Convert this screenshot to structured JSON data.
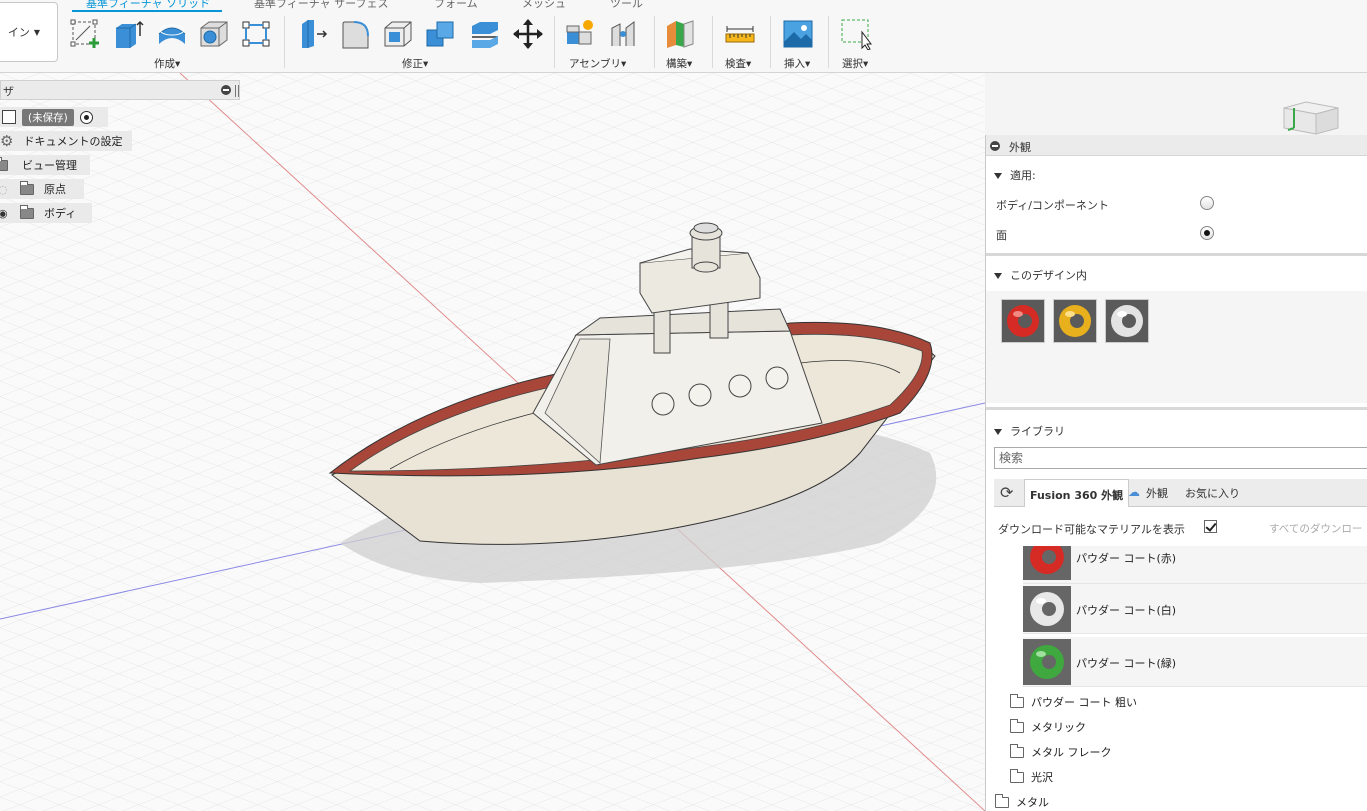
{
  "toolbar": {
    "workspace_label": "イン",
    "tabs": [
      {
        "label": "基準フィーチャ ソリッド",
        "active": true
      },
      {
        "label": "基準フィーチャ サーフェス",
        "active": false
      },
      {
        "label": "フォーム",
        "active": false
      },
      {
        "label": "メッシュ",
        "active": false
      },
      {
        "label": "ツール",
        "active": false
      }
    ],
    "groups": {
      "create": "作成▾",
      "modify": "修正▾",
      "assemble": "アセンブリ▾",
      "construct": "構築▾",
      "inspect": "検査▾",
      "insert": "挿入▾",
      "select": "選択▾"
    }
  },
  "browser": {
    "title": "ザ",
    "document": "(未保存)",
    "items": [
      {
        "label": "ドキュメントの設定",
        "icon": "gear-icon"
      },
      {
        "label": "ビュー管理",
        "icon": "folder-icon"
      },
      {
        "label": "原点",
        "icon": "folder-icon"
      },
      {
        "label": "ボディ",
        "icon": "folder-icon"
      }
    ]
  },
  "panel": {
    "title": "外観",
    "apply": {
      "title": "適用:",
      "body_component": "ボディ/コンポーネント",
      "face": "面",
      "selected": "face"
    },
    "in_design": {
      "title": "このデザイン内",
      "swatches": [
        {
          "color": "#d62b24"
        },
        {
          "color": "#e8b01c"
        },
        {
          "color": "#e3e3e3"
        }
      ]
    },
    "library": {
      "title": "ライブラリ",
      "search_placeholder": "検索",
      "tabs": [
        "Fusion 360 外観",
        "外観",
        "お気に入り"
      ],
      "show_downloadable": "ダウンロード可能なマテリアルを表示",
      "download_all": "すべてのダウンロー",
      "materials": [
        {
          "label": "パウダー コート(赤)",
          "color": "#d62b24"
        },
        {
          "label": "パウダー コート(白)",
          "color": "#e8e8e8"
        },
        {
          "label": "パウダー コート(緑)",
          "color": "#3fa83f"
        }
      ],
      "folders": [
        "パウダー コート 粗い",
        "メタリック",
        "メタル フレーク",
        "光沢"
      ],
      "root_folder": "メタル"
    }
  },
  "colors": {
    "accent": "#0696d7",
    "hull_rim": "#a8463a",
    "hull": "#e7e1d4"
  }
}
